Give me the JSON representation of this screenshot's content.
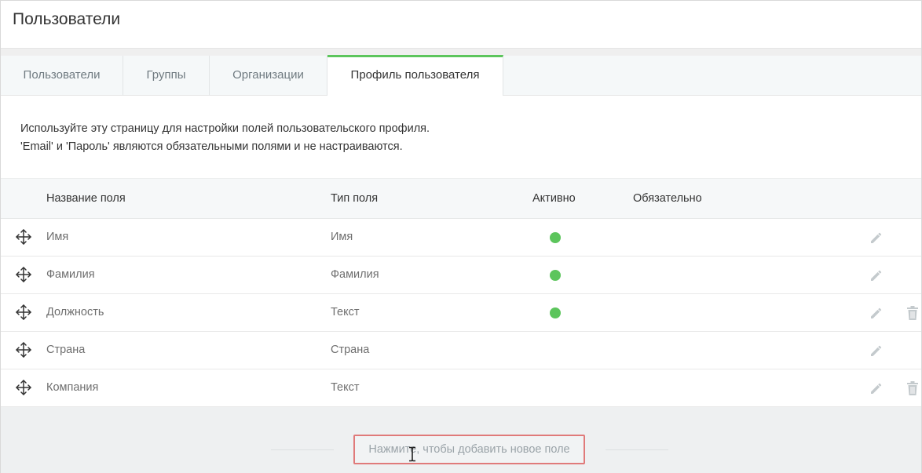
{
  "header": {
    "title": "Пользователи"
  },
  "tabs": [
    {
      "label": "Пользователи",
      "active": false
    },
    {
      "label": "Группы",
      "active": false
    },
    {
      "label": "Организации",
      "active": false
    },
    {
      "label": "Профиль пользователя",
      "active": true
    }
  ],
  "description": {
    "line1": "Используйте эту страницу для настройки полей пользовательского профиля.",
    "line2": "'Email' и 'Пароль' являются обязательными полями и не настраиваются."
  },
  "table": {
    "columns": {
      "name": "Название поля",
      "type": "Тип поля",
      "active": "Активно",
      "required": "Обязательно"
    },
    "rows": [
      {
        "name": "Имя",
        "type": "Имя",
        "active": true,
        "deletable": false
      },
      {
        "name": "Фамилия",
        "type": "Фамилия",
        "active": true,
        "deletable": false
      },
      {
        "name": "Должность",
        "type": "Текст",
        "active": true,
        "deletable": true
      },
      {
        "name": "Страна",
        "type": "Страна",
        "active": false,
        "deletable": false
      },
      {
        "name": "Компания",
        "type": "Текст",
        "active": false,
        "deletable": true
      }
    ]
  },
  "footer": {
    "add_label": "Нажмите, чтобы добавить новое поле"
  },
  "colors": {
    "accent": "#5cc55c",
    "active_dot": "#5cc55c",
    "highlight": "#e07a7a"
  },
  "icons": {
    "drag": "move-arrows-icon",
    "edit": "pencil-icon",
    "delete": "trash-icon"
  }
}
